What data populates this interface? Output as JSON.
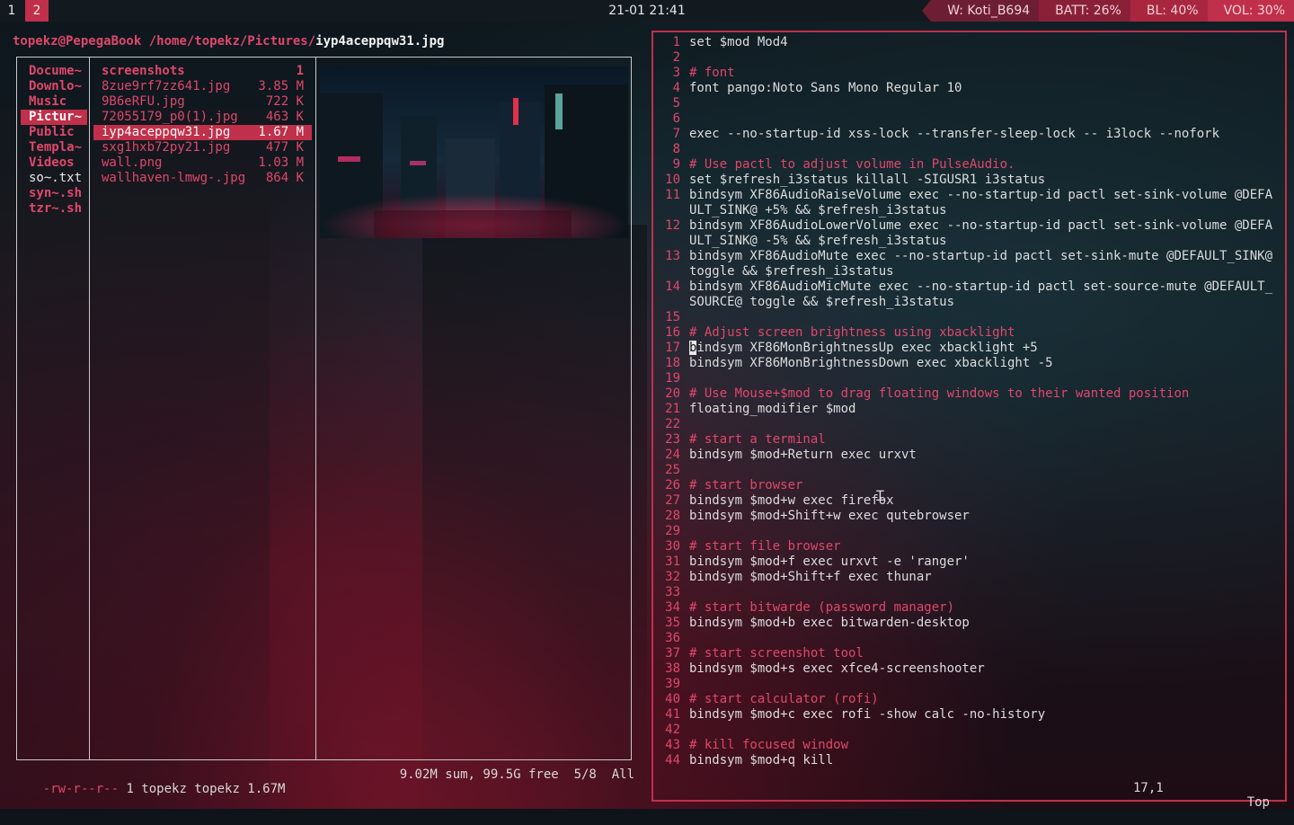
{
  "topbar": {
    "workspaces": [
      {
        "label": "1",
        "active": false
      },
      {
        "label": "2",
        "active": true
      }
    ],
    "clock": "21-01 21:41",
    "status": [
      {
        "label": "W: Koti_B694"
      },
      {
        "label": "BATT: 26%"
      },
      {
        "label": "BL: 40%"
      },
      {
        "label": "VOL: 30%"
      }
    ]
  },
  "ranger": {
    "title": {
      "host": "topekz@PepegaBook",
      "path": "/home/topekz/Pictures/",
      "file": "iyp4aceppqw31.jpg"
    },
    "parent_dirs": [
      {
        "name": "Docume~",
        "type": "dir"
      },
      {
        "name": "Downlo~",
        "type": "dir"
      },
      {
        "name": "Music",
        "type": "dir"
      },
      {
        "name": "Pictur~",
        "type": "dir",
        "selected": true
      },
      {
        "name": "Public",
        "type": "dir"
      },
      {
        "name": "Templa~",
        "type": "dir"
      },
      {
        "name": "Videos",
        "type": "dir"
      },
      {
        "name": "so~.txt",
        "type": "file"
      },
      {
        "name": "syn~.sh",
        "type": "dir"
      },
      {
        "name": "tzr~.sh",
        "type": "dir"
      }
    ],
    "files": [
      {
        "name": "screenshots",
        "size": "1",
        "dir": true
      },
      {
        "name": "8zue9rf7zz641.jpg",
        "size": "3.85 M"
      },
      {
        "name": "9B6eRFU.jpg",
        "size": "722 K"
      },
      {
        "name": "72055179_p0(1).jpg",
        "size": "463 K"
      },
      {
        "name": "iyp4aceppqw31.jpg",
        "size": "1.67 M",
        "selected": true
      },
      {
        "name": "sxg1hxb72py21.jpg",
        "size": "477 K"
      },
      {
        "name": "wall.png",
        "size": "1.03 M"
      },
      {
        "name": "wallhaven-lmwg-.jpg",
        "size": "864 K"
      }
    ],
    "statusbar": {
      "perms": "-rw-r--r--",
      "info": " 1 topekz topekz 1.67M",
      "right": "9.02M sum, 99.5G free  5/8  All"
    }
  },
  "vim": {
    "lines": [
      {
        "n": "1",
        "t": "set $mod Mod4"
      },
      {
        "n": "2",
        "t": ""
      },
      {
        "n": "3",
        "t": "# font",
        "c": true
      },
      {
        "n": "4",
        "t": "font pango:Noto Sans Mono Regular 10"
      },
      {
        "n": "5",
        "t": ""
      },
      {
        "n": "6",
        "t": ""
      },
      {
        "n": "7",
        "t": "exec --no-startup-id xss-lock --transfer-sleep-lock -- i3lock --nofork"
      },
      {
        "n": "8",
        "t": ""
      },
      {
        "n": "9",
        "t": "# Use pactl to adjust volume in PulseAudio.",
        "c": true
      },
      {
        "n": "10",
        "t": "set $refresh_i3status killall -SIGUSR1 i3status"
      },
      {
        "n": "11",
        "t": "bindsym XF86AudioRaiseVolume exec --no-startup-id pactl set-sink-volume @DEFAULT_SINK@ +5% && $refresh_i3status"
      },
      {
        "n": "12",
        "t": "bindsym XF86AudioLowerVolume exec --no-startup-id pactl set-sink-volume @DEFAULT_SINK@ -5% && $refresh_i3status"
      },
      {
        "n": "13",
        "t": "bindsym XF86AudioMute exec --no-startup-id pactl set-sink-mute @DEFAULT_SINK@ toggle && $refresh_i3status"
      },
      {
        "n": "14",
        "t": "bindsym XF86AudioMicMute exec --no-startup-id pactl set-source-mute @DEFAULT_SOURCE@ toggle && $refresh_i3status"
      },
      {
        "n": "15",
        "t": ""
      },
      {
        "n": "16",
        "t": "# Adjust screen brightness using xbacklight",
        "c": true
      },
      {
        "n": "17",
        "t": "bindsym XF86MonBrightnessUp exec xbacklight +5",
        "cursor": true
      },
      {
        "n": "18",
        "t": "bindsym XF86MonBrightnessDown exec xbacklight -5"
      },
      {
        "n": "19",
        "t": ""
      },
      {
        "n": "20",
        "t": "# Use Mouse+$mod to drag floating windows to their wanted position",
        "c": true
      },
      {
        "n": "21",
        "t": "floating_modifier $mod"
      },
      {
        "n": "22",
        "t": ""
      },
      {
        "n": "23",
        "t": "# start a terminal",
        "c": true
      },
      {
        "n": "24",
        "t": "bindsym $mod+Return exec urxvt"
      },
      {
        "n": "25",
        "t": ""
      },
      {
        "n": "26",
        "t": "# start browser",
        "c": true
      },
      {
        "n": "27",
        "t": "bindsym $mod+w exec firefox"
      },
      {
        "n": "28",
        "t": "bindsym $mod+Shift+w exec qutebrowser"
      },
      {
        "n": "29",
        "t": ""
      },
      {
        "n": "30",
        "t": "# start file browser",
        "c": true
      },
      {
        "n": "31",
        "t": "bindsym $mod+f exec urxvt -e 'ranger'"
      },
      {
        "n": "32",
        "t": "bindsym $mod+Shift+f exec thunar"
      },
      {
        "n": "33",
        "t": ""
      },
      {
        "n": "34",
        "t": "# start bitwarde (password manager)",
        "c": true
      },
      {
        "n": "35",
        "t": "bindsym $mod+b exec bitwarden-desktop"
      },
      {
        "n": "36",
        "t": ""
      },
      {
        "n": "37",
        "t": "# start screenshot tool",
        "c": true
      },
      {
        "n": "38",
        "t": "bindsym $mod+s exec xfce4-screenshooter"
      },
      {
        "n": "39",
        "t": ""
      },
      {
        "n": "40",
        "t": "# start calculator (rofi)",
        "c": true
      },
      {
        "n": "41",
        "t": "bindsym $mod+c exec rofi -show calc -no-history"
      },
      {
        "n": "42",
        "t": ""
      },
      {
        "n": "43",
        "t": "# kill focused window",
        "c": true
      },
      {
        "n": "44",
        "t": "bindsym $mod+q kill"
      }
    ],
    "statusbar": {
      "position": "17,1",
      "scroll": "Top"
    }
  },
  "colors": {
    "accent": "#c0304a",
    "comment": "#e0476a",
    "bar": "#121a20"
  }
}
